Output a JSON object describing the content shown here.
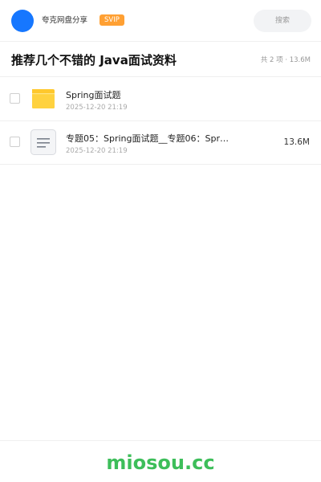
{
  "header": {
    "share_name": "夸克网盘分享",
    "vip_label": "SVIP",
    "search_placeholder": "搜索",
    "avatar_color": "#1677ff",
    "vip_color": "#ffa033"
  },
  "title_bar": {
    "title": "推荐几个不错的 Java面试资料",
    "summary": "共 2 项 · 13.6M"
  },
  "files": [
    {
      "type": "folder",
      "icon": "folder-icon",
      "name": "Spring面试题",
      "date": "2025-12-20 21:19",
      "size": ""
    },
    {
      "type": "document",
      "icon": "document-icon",
      "name": "专题05：Spring面试题__专题06：Spring…",
      "date": "2025-12-20 21:19",
      "size": "13.6M"
    }
  ],
  "footer": {
    "brand": "miosou.cc",
    "brand_color": "#3dbe5a"
  }
}
